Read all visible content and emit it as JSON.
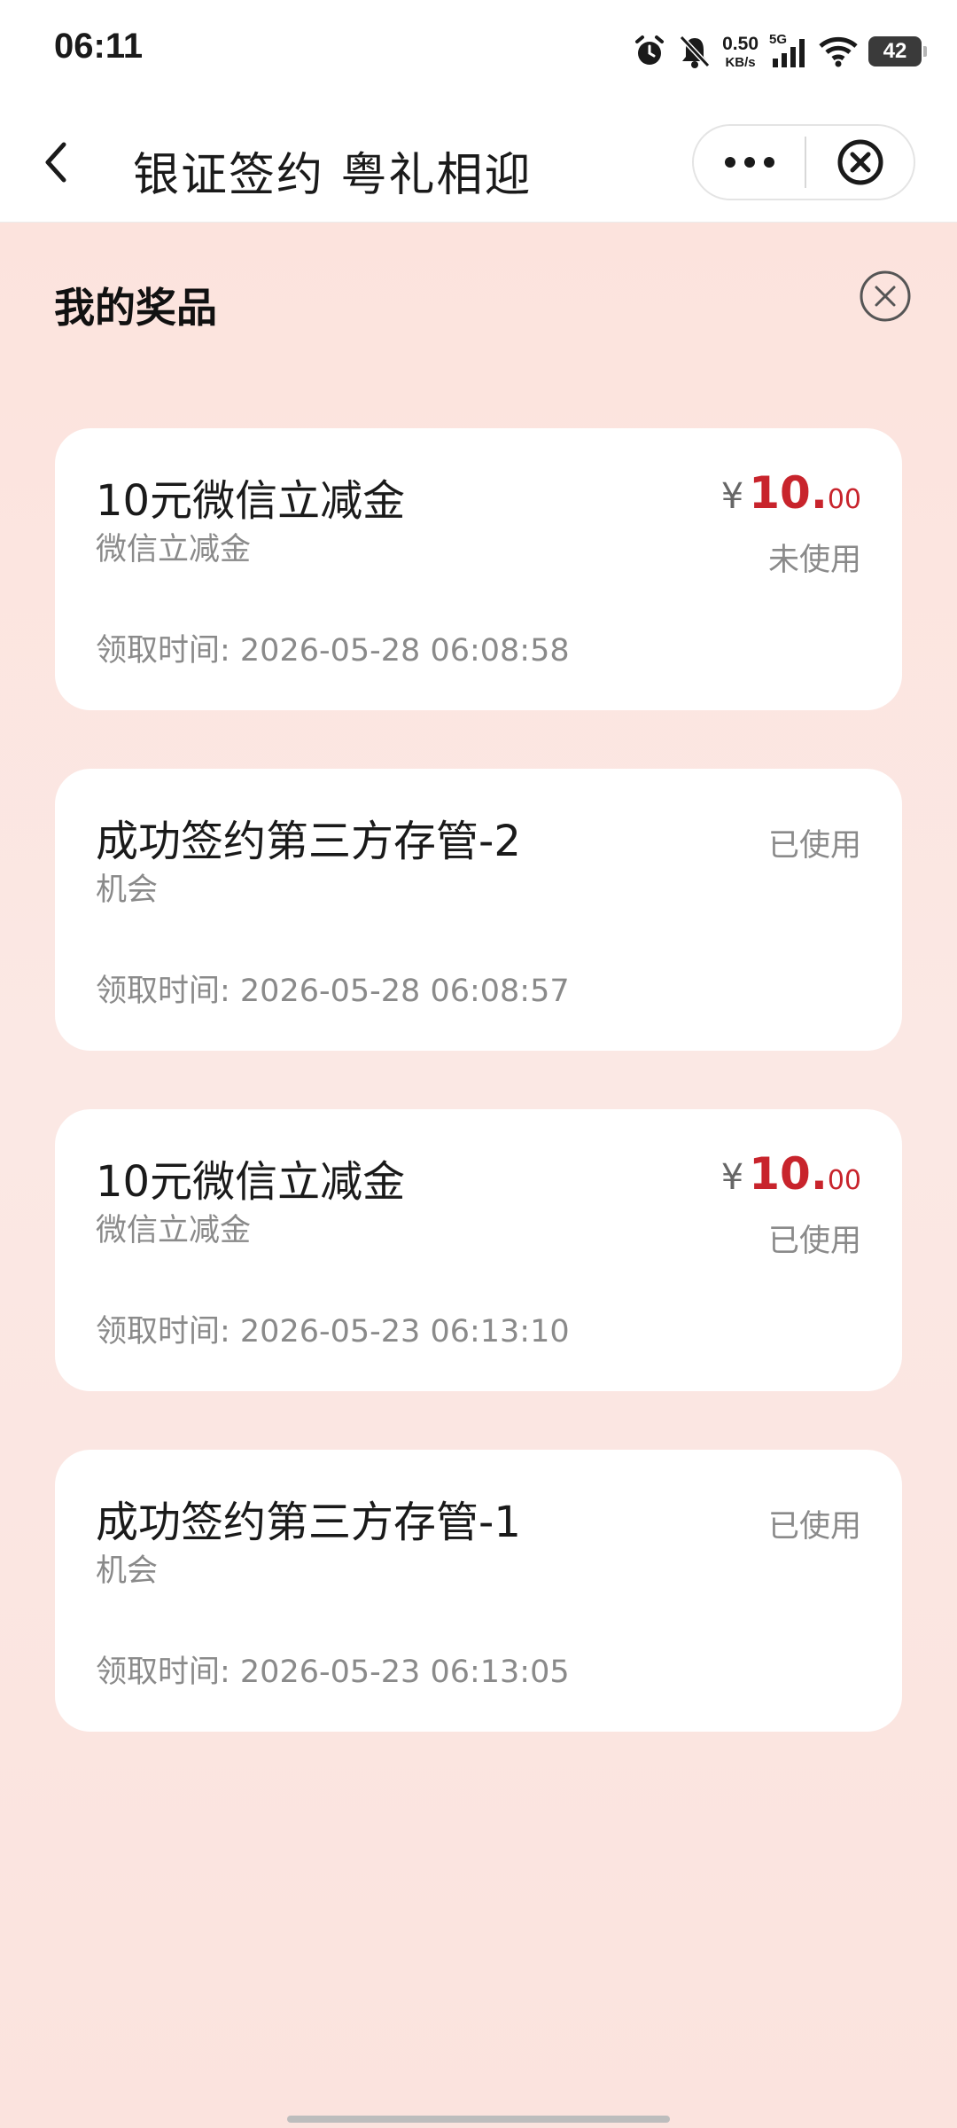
{
  "status_bar": {
    "time": "06:11",
    "net_speed_value": "0.50",
    "net_speed_unit": "KB/s",
    "network_type": "5G",
    "battery_level": "42",
    "icons": [
      "alarm-icon",
      "mute-bell-icon",
      "signal-icon",
      "wifi-icon",
      "battery-icon"
    ]
  },
  "nav": {
    "title": "银证签约 粤礼相迎",
    "icons": [
      "back-arrow-icon",
      "more-dots-icon",
      "close-circle-icon"
    ]
  },
  "prizes_panel": {
    "title": "我的奖品",
    "close_icon": "close-circle-icon"
  },
  "prizes": [
    {
      "name": "10元微信立减金",
      "subtype": "微信立减金",
      "currency": "¥",
      "amount_int": "10.",
      "amount_dec": "00",
      "status": "未使用",
      "time": "领取时间: 2026-05-28 06:08:58"
    },
    {
      "name": "成功签约第三方存管-2",
      "subtype": "机会",
      "status": "已使用",
      "time": "领取时间: 2026-05-28 06:08:57"
    },
    {
      "name": "10元微信立减金",
      "subtype": "微信立减金",
      "currency": "¥",
      "amount_int": "10.",
      "amount_dec": "00",
      "status": "已使用",
      "time": "领取时间: 2026-05-23 06:13:10"
    },
    {
      "name": "成功签约第三方存管-1",
      "subtype": "机会",
      "status": "已使用",
      "time": "领取时间: 2026-05-23 06:13:05"
    }
  ],
  "colors": {
    "accent_price": "#c8242c",
    "panel_background": "#fbe5e0",
    "muted_text": "#8a8a8a"
  }
}
